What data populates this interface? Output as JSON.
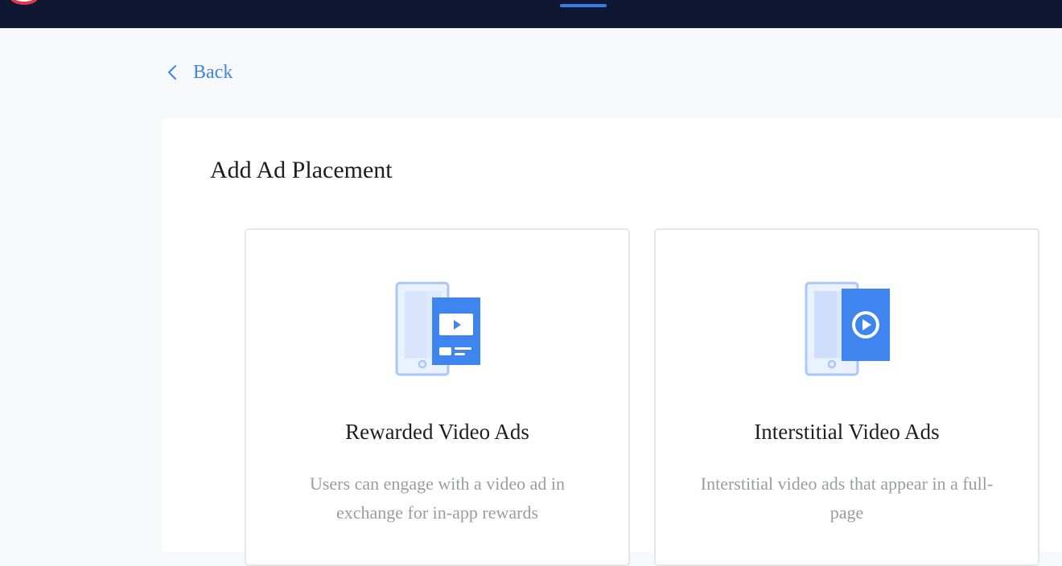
{
  "nav": {
    "back_label": "Back"
  },
  "page": {
    "title": "Add Ad Placement"
  },
  "placements": [
    {
      "title": "Rewarded Video Ads",
      "description": "Users can engage with a video ad in exchange for in-app rewards",
      "icon": "rewarded-video-illustration"
    },
    {
      "title": "Interstitial Video Ads",
      "description": "Interstitial video ads that appear in a full-page",
      "icon": "interstitial-video-illustration"
    }
  ],
  "colors": {
    "topbar": "#0f1733",
    "accent": "#3d7be8",
    "link": "#3d86e6",
    "muted_text": "#9a9ca3"
  }
}
